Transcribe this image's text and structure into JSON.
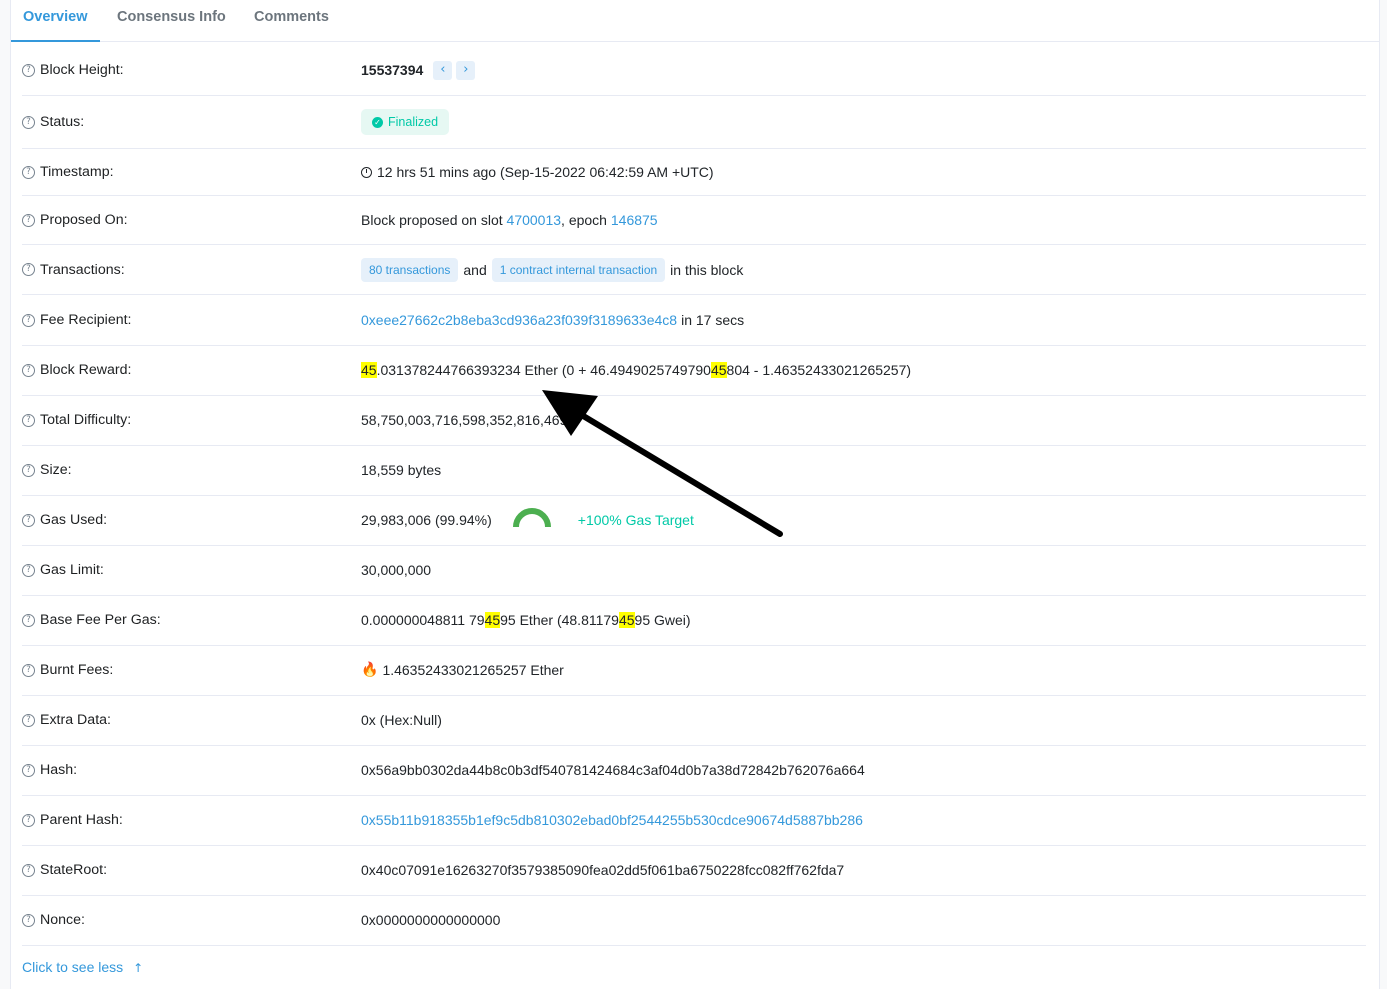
{
  "tabs": [
    {
      "label": "Overview",
      "active": true
    },
    {
      "label": "Consensus Info",
      "active": false
    },
    {
      "label": "Comments",
      "active": false
    }
  ],
  "rows": {
    "block_height": {
      "label": "Block Height:",
      "value": "15537394",
      "prev_icon": "chevron-left-icon",
      "next_icon": "chevron-right-icon"
    },
    "status": {
      "label": "Status:",
      "value": "Finalized"
    },
    "timestamp": {
      "label": "Timestamp:",
      "value": "12 hrs 51 mins ago (Sep-15-2022 06:42:59 AM +UTC)"
    },
    "proposed_on": {
      "label": "Proposed On:",
      "prefix": "Block proposed on slot ",
      "slot": "4700013",
      "middle": ", epoch ",
      "epoch": "146875"
    },
    "transactions": {
      "label": "Transactions:",
      "txs": "80 transactions",
      "and": "and",
      "internal": "1 contract internal transaction",
      "suffix": "in this block"
    },
    "fee_recipient": {
      "label": "Fee Recipient:",
      "address": "0xeee27662c2b8eba3cd936a23f039f3189633e4c8",
      "suffix": "in 17 secs"
    },
    "block_reward": {
      "label": "Block Reward:",
      "hl1": "45",
      "part1": ".031378244766393234 Ether (0 + 46.4949025749790",
      "hl2": "45",
      "part2": "804 - 1.46352433021265257)"
    },
    "total_difficulty": {
      "label": "Total Difficulty:",
      "value": "58,750,003,716,598,352,816,469"
    },
    "size": {
      "label": "Size:",
      "value": "18,559 bytes"
    },
    "gas_used": {
      "label": "Gas Used:",
      "value": "29,983,006 (99.94%)",
      "target": "+100% Gas Target",
      "gauge_color": "#4caf50"
    },
    "gas_limit": {
      "label": "Gas Limit:",
      "value": "30,000,000"
    },
    "base_fee": {
      "label": "Base Fee Per Gas:",
      "part1": "0.000000048811 79",
      "hl1": "45",
      "part2": "95 Ether (48.81179",
      "hl2": "45",
      "part3": "95 Gwei)"
    },
    "burnt_fees": {
      "label": "Burnt Fees:",
      "icon": "flame-icon",
      "value": "1.46352433021265257 Ether"
    },
    "extra_data": {
      "label": "Extra Data:",
      "value": "0x (Hex:Null)"
    },
    "hash": {
      "label": "Hash:",
      "value": "0x56a9bb0302da44b8c0b3df540781424684c3af04d0b7a38d72842b762076a664"
    },
    "parent_hash": {
      "label": "Parent Hash:",
      "value": "0x55b11b918355b1ef9c5db810302ebad0bf2544255b530cdce90674d5887bb286"
    },
    "stateroot": {
      "label": "StateRoot:",
      "value": "0x40c07091e16263270f3579385090fea02dd5f061ba6750228fcc082ff762fda7"
    },
    "nonce": {
      "label": "Nonce:",
      "value": "0x0000000000000000"
    }
  },
  "footer": {
    "see_less": "Click to see less",
    "arrow_icon": "arrow-up-icon"
  },
  "colors": {
    "link": "#3498db",
    "success": "#00c9a7",
    "highlight": "#ffff00"
  }
}
